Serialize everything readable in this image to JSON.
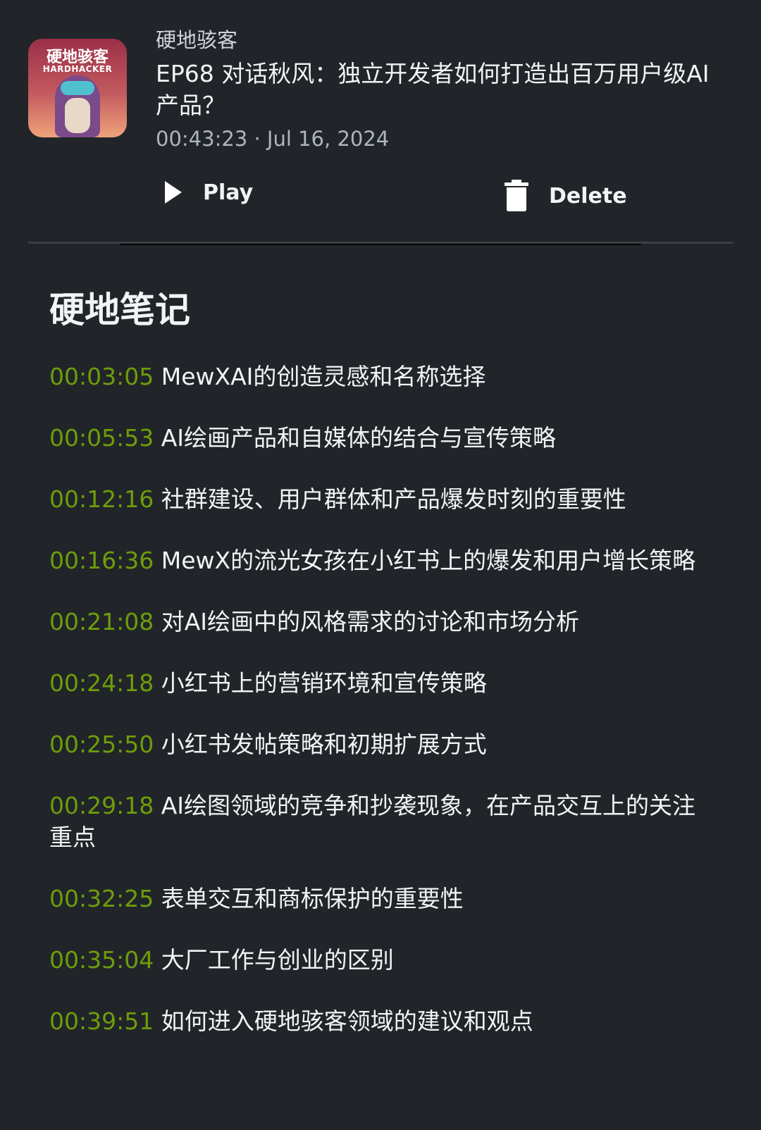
{
  "episode": {
    "cover_text": "硬地骇客",
    "cover_subtext": "HARDHACKER",
    "podcast": "硬地骇客",
    "title": "EP68 对话秋风：独立开发者如何打造出百万用户级AI产品？",
    "meta": "00:43:23 · Jul 16, 2024"
  },
  "actions": {
    "play": "Play",
    "delete": "Delete"
  },
  "notes": {
    "title": "硬地笔记",
    "items": [
      {
        "time": "00:03:05",
        "text": "MewXAI的创造灵感和名称选择"
      },
      {
        "time": "00:05:53",
        "text": "AI绘画产品和自媒体的结合与宣传策略"
      },
      {
        "time": "00:12:16",
        "text": "社群建设、用户群体和产品爆发时刻的重要性"
      },
      {
        "time": "00:16:36",
        "text": "MewX的流光女孩在小红书上的爆发和用户增长策略"
      },
      {
        "time": "00:21:08",
        "text": "对AI绘画中的风格需求的讨论和市场分析"
      },
      {
        "time": "00:24:18",
        "text": "小红书上的营销环境和宣传策略"
      },
      {
        "time": "00:25:50",
        "text": "小红书发帖策略和初期扩展方式"
      },
      {
        "time": "00:29:18",
        "text": "AI绘图领域的竞争和抄袭现象，在产品交互上的关注重点"
      },
      {
        "time": "00:32:25",
        "text": "表单交互和商标保护的重要性"
      },
      {
        "time": "00:35:04",
        "text": "大厂工作与创业的区别"
      },
      {
        "time": "00:39:51",
        "text": "如何进入硬地骇客领域的建议和观点"
      }
    ]
  },
  "colors": {
    "background": "#212529",
    "timestamp": "#6e9d0a"
  }
}
